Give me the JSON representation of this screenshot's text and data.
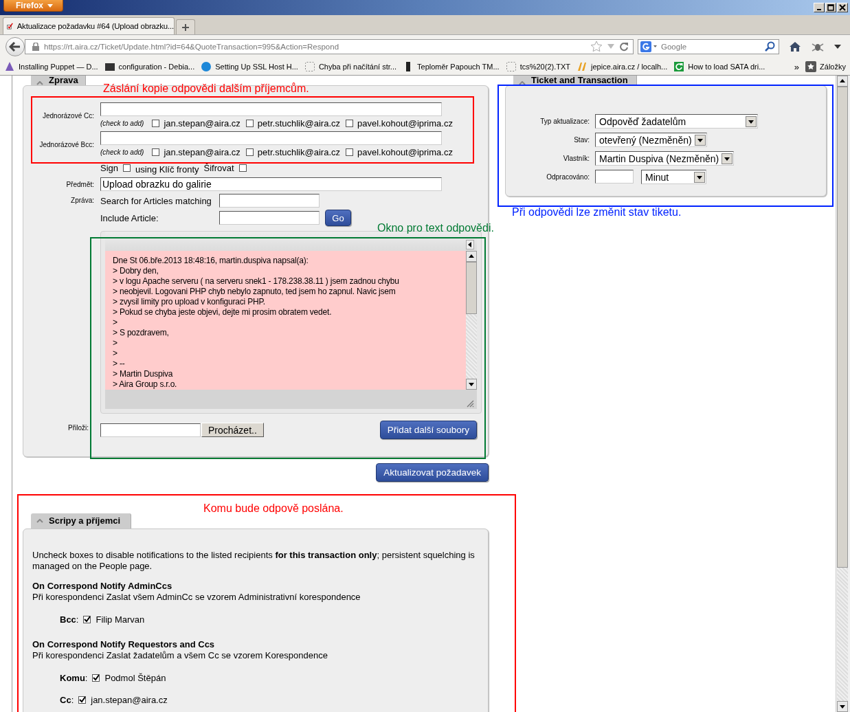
{
  "browser": {
    "menu_button": "Firefox",
    "tabs": [
      {
        "title": "Aktualizace požadavku #64 (Upload obrazku...",
        "selected": true
      }
    ],
    "url_host": "https://rt.aira.cz",
    "url_path": "/Ticket/Update.html?id=64&QuoteTransaction=995&Action=Respond",
    "search_placeholder": "Google",
    "bookmarks": [
      {
        "title": "Installing Puppet — D..."
      },
      {
        "title": "configuration - Debia..."
      },
      {
        "title": "Setting Up SSL Host H..."
      },
      {
        "title": "Chyba při načítání str..."
      },
      {
        "title": "Teploměr Papouch TM..."
      },
      {
        "title": "tcs%20(2).TXT"
      },
      {
        "title": "jepice.aira.cz / localh..."
      },
      {
        "title": "How to load SATA dri..."
      }
    ],
    "bookmarks_overflow": "»",
    "bookmarks_menu": "Záložky"
  },
  "message": {
    "tab": "Zprava",
    "cc": {
      "label": "Jednorázové Cc:",
      "hint": "(check to add)",
      "recipients": [
        {
          "email": "jan.stepan@aira.cz",
          "checked": false
        },
        {
          "email": "petr.stuchlik@aira.cz",
          "checked": false
        },
        {
          "email": "pavel.kohout@iprima.cz",
          "checked": false
        }
      ]
    },
    "bcc": {
      "label": "Jednorázové Bcc:",
      "hint": "(check to add)",
      "recipients": [
        {
          "email": "jan.stepan@aira.cz",
          "checked": false
        },
        {
          "email": "petr.stuchlik@aira.cz",
          "checked": false
        },
        {
          "email": "pavel.kohout@iprima.cz",
          "checked": false
        }
      ]
    },
    "sign": {
      "label": "Sign",
      "checked": false
    },
    "key_label": "using Klíč fronty",
    "encrypt": {
      "label": "Šifrovat",
      "checked": false
    },
    "subject": {
      "label": "Předmět:",
      "value": "Upload obrazku do galirie"
    },
    "body_label": "Zpráva:",
    "article_search_label": "Search for Articles matching",
    "include_article_label": "Include Article:",
    "go_button": "Go",
    "body_lines": [
      "Dne St 06.bře.2013 18:48:16, martin.duspiva napsal(a):",
      "> Dobry den,",
      "> v logu Apache serveru ( na serveru snek1 - 178.238.38.11 ) jsem zadnou chybu",
      "> neobjevil. Logovani PHP chyb nebylo zapnuto, ted jsem ho zapnul. Navic jsem",
      "> zvysil limity pro upload v konfiguraci PHP.",
      "> Pokud se chyba jeste objevi, dejte mi prosim obratem vedet.",
      ">",
      "> S pozdravem,",
      ">",
      ">",
      "> --",
      "> Martin Duspiva",
      "> Aira Group s.r.o."
    ],
    "attach_label": "Přiloži:",
    "browse_button": "Procházet..",
    "add_files_button": "Přidat další soubory"
  },
  "submit_button": "Aktualizovat požadavek",
  "ticket": {
    "tab": "Ticket and Transaction",
    "fields": [
      {
        "label": "Typ aktualizace:",
        "kind": "select",
        "value": "Odpověď žadatelům"
      },
      {
        "label": "Stav:",
        "kind": "select",
        "value": "otevřený (Nezměněn)"
      },
      {
        "label": "Vlastník:",
        "kind": "select",
        "value": "Martin Duspiva (Nezměněn)"
      },
      {
        "label": "Odpracováno:",
        "kind": "time",
        "value": "Minut"
      }
    ]
  },
  "scrips": {
    "tab": "Scripy a příjemci",
    "intro": "Uncheck boxes to disable notifications to the listed recipients **for this transaction only**; persistent squelching is managed on the People page.",
    "groups": [
      {
        "title": "On Correspond Notify AdminCcs",
        "description": "Při korespondenci Zaslat všem AdminCc se vzorem Administrativní korespondence",
        "recipients": [
          {
            "role": "**Bcc**:",
            "name": "Filip Marvan",
            "checked": true
          }
        ]
      },
      {
        "title": "On Correspond Notify Requestors and Ccs",
        "description": "Při korespondenci Zaslat žadatelům a všem Cc se vzorem Korespondence",
        "recipients": [
          {
            "role": "**Komu**:",
            "name": "Podmol Štěpán",
            "checked": true
          },
          {
            "role": "**Cc**:",
            "name": "jan.stepan@aira.cz",
            "checked": true
          }
        ]
      }
    ]
  },
  "annotations": [
    {
      "text": "Záslání kopie odpovědi dalším příjemcům.",
      "color": "#ff0000"
    },
    {
      "text": "Okno pro text odpovědi.",
      "color": "#007a33"
    },
    {
      "text": "Při odpovědi lze změnit stav tiketu.",
      "color": "#0022ff"
    },
    {
      "text": "Komu bude odpově poslána.",
      "color": "#ff0000"
    }
  ]
}
